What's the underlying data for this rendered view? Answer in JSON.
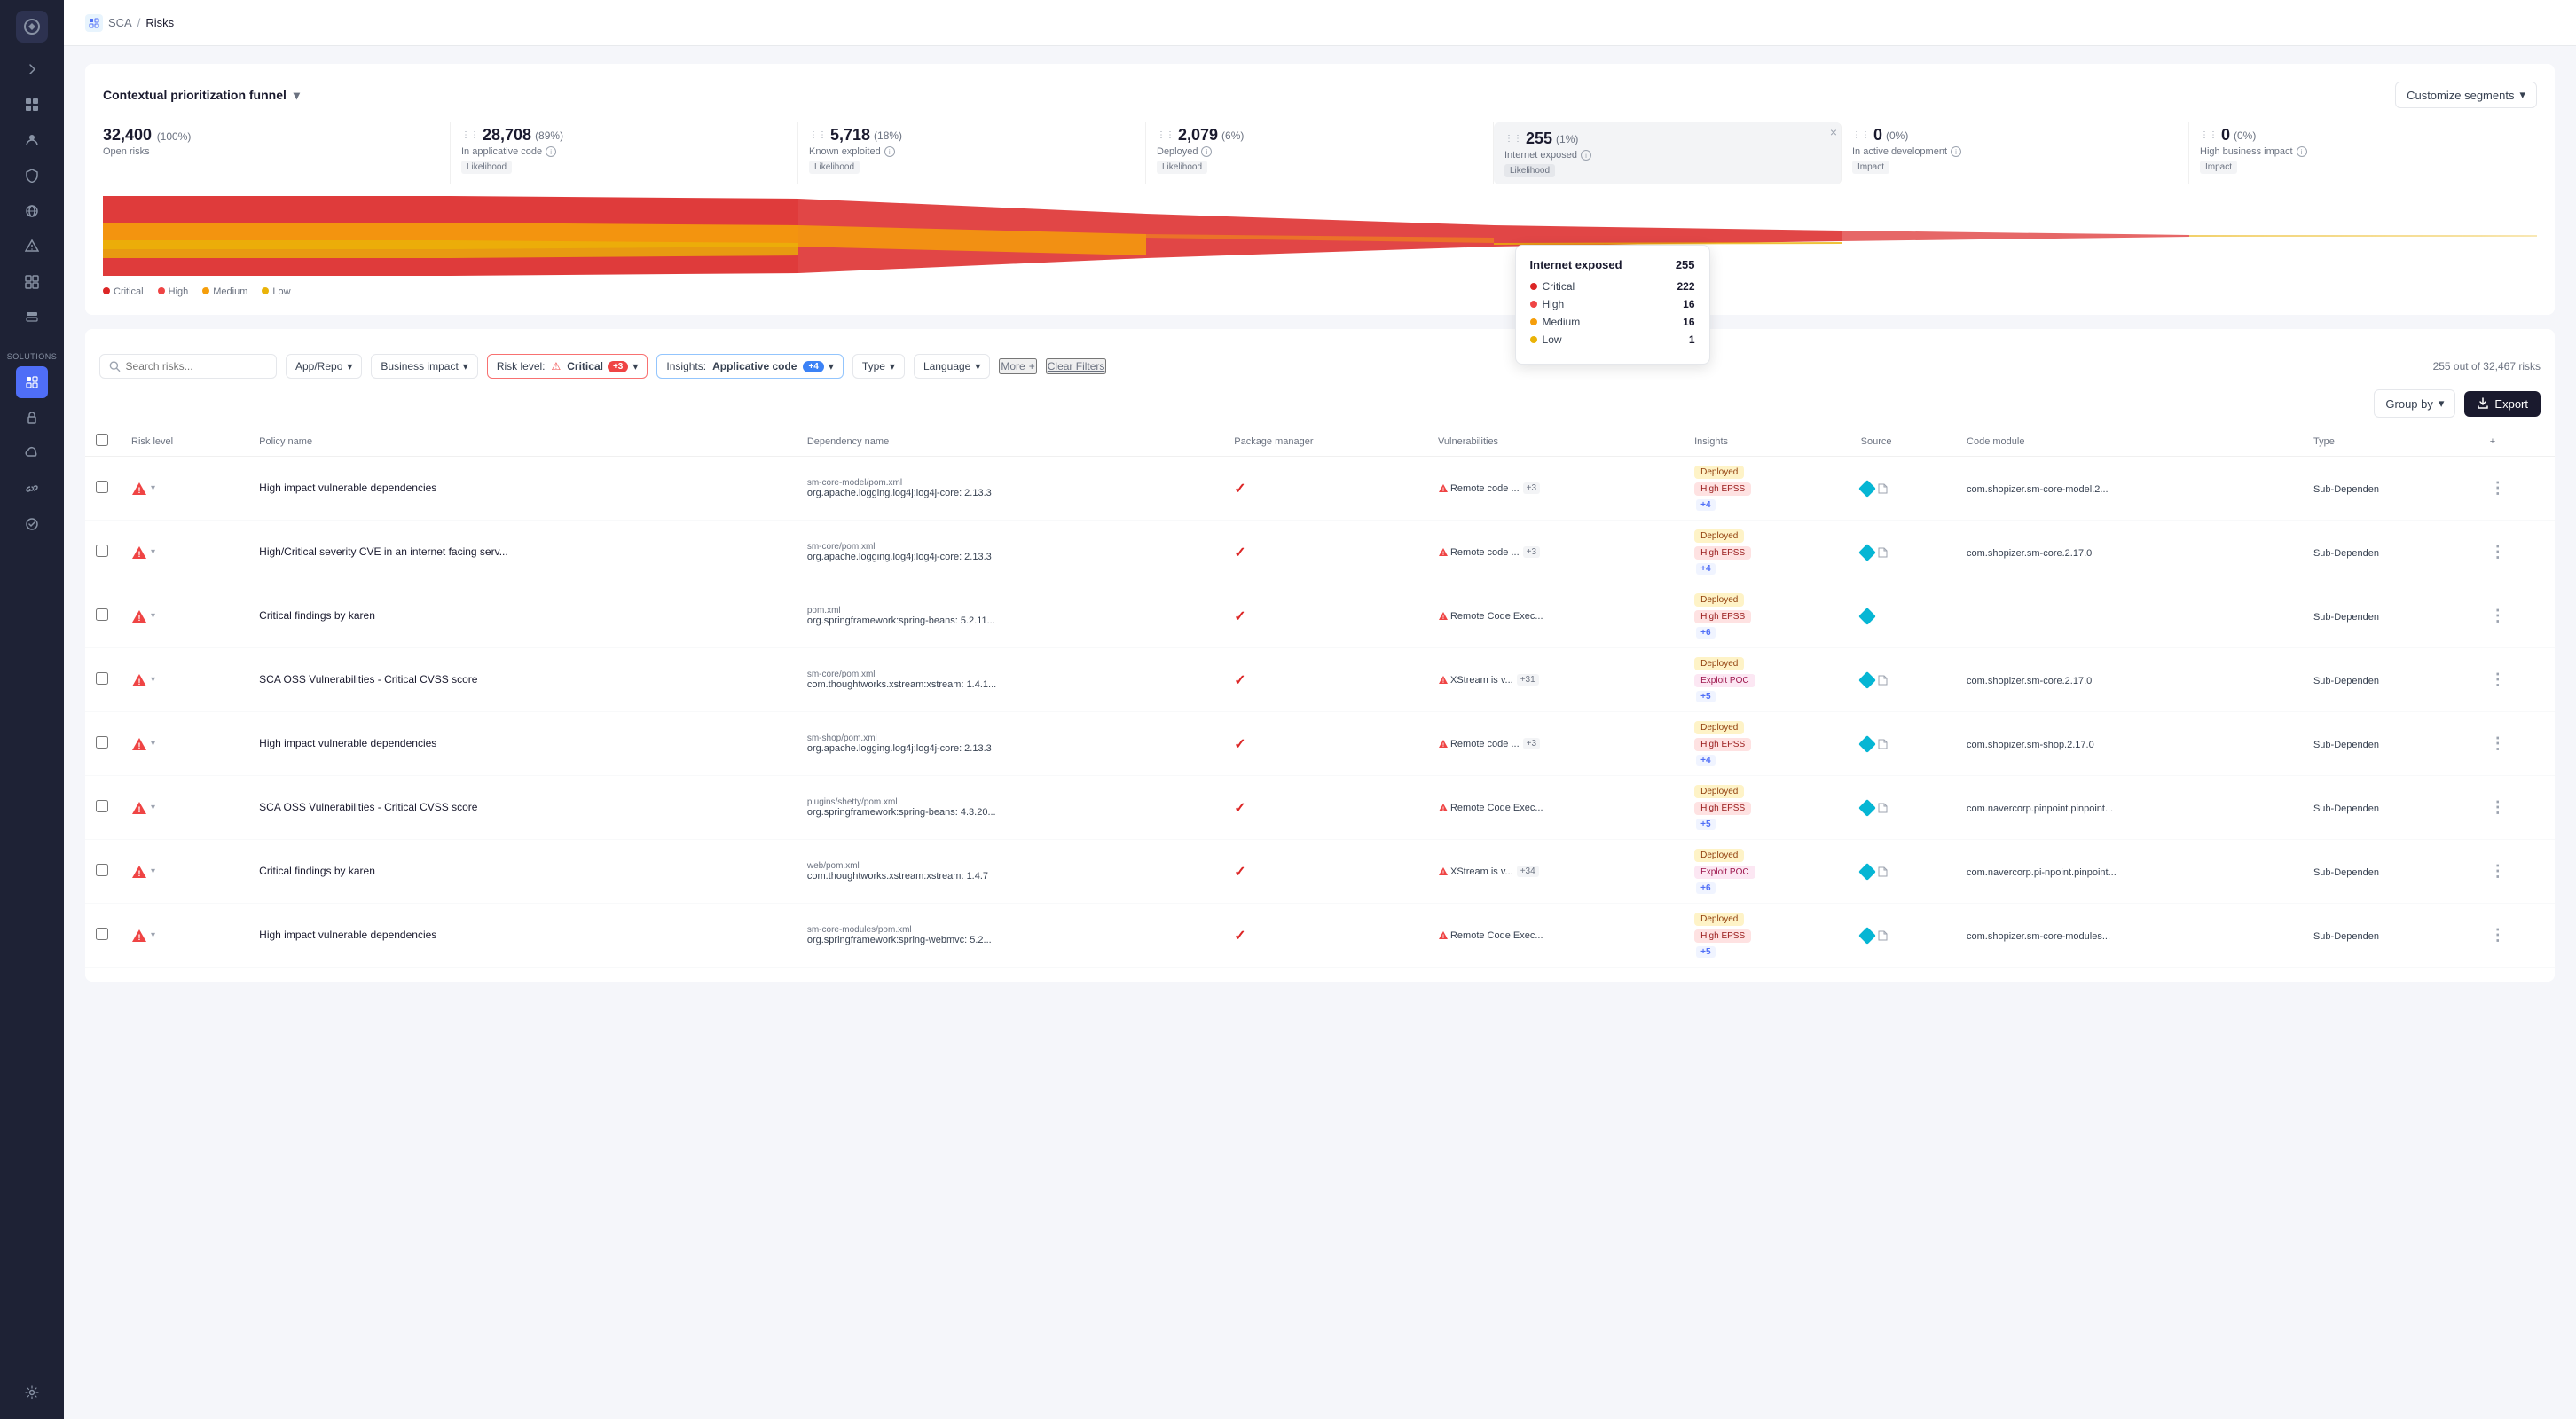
{
  "app": {
    "title": "SCA",
    "breadcrumb_sep": "/",
    "breadcrumb_current": "Risks"
  },
  "sidebar": {
    "solutions_label": "SOLUTIONS",
    "icons": [
      {
        "name": "expand-icon",
        "glyph": "⟩",
        "active": false
      },
      {
        "name": "dashboard-icon",
        "glyph": "○",
        "active": false
      },
      {
        "name": "team-icon",
        "glyph": "⊙",
        "active": false
      },
      {
        "name": "shield-icon",
        "glyph": "◻",
        "active": false
      },
      {
        "name": "globe-icon",
        "glyph": "◎",
        "active": false
      },
      {
        "name": "alert-icon",
        "glyph": "◈",
        "active": false
      },
      {
        "name": "widget-icon",
        "glyph": "⊞",
        "active": false
      },
      {
        "name": "box-icon",
        "glyph": "◧",
        "active": false
      },
      {
        "name": "sca-icon",
        "glyph": "◈",
        "active": true
      },
      {
        "name": "lock-icon",
        "glyph": "◻",
        "active": false
      },
      {
        "name": "cloud-icon",
        "glyph": "⊡",
        "active": false
      },
      {
        "name": "infinity-icon",
        "glyph": "∞",
        "active": false
      },
      {
        "name": "guard-icon",
        "glyph": "◎",
        "active": false
      },
      {
        "name": "settings-icon",
        "glyph": "⚙",
        "active": false
      }
    ]
  },
  "funnel": {
    "title": "Contextual prioritization funnel",
    "customize_label": "Customize segments",
    "segments": [
      {
        "number": "32,400",
        "pct": "(100%)",
        "label": "Open risks",
        "badge": "",
        "info": true,
        "likelihood": false,
        "impact": false,
        "close": false,
        "highlighted": false,
        "drag": false
      },
      {
        "number": "28,708",
        "pct": "(89%)",
        "label": "In applicative code",
        "badge": "Likelihood",
        "info": true,
        "close": false,
        "highlighted": false,
        "drag": true
      },
      {
        "number": "5,718",
        "pct": "(18%)",
        "label": "Known exploited",
        "badge": "Likelihood",
        "info": true,
        "close": false,
        "highlighted": false,
        "drag": true
      },
      {
        "number": "2,079",
        "pct": "(6%)",
        "label": "Deployed",
        "badge": "Likelihood",
        "info": true,
        "close": false,
        "highlighted": false,
        "drag": true
      },
      {
        "number": "255",
        "pct": "(1%)",
        "label": "Internet exposed",
        "badge": "Likelihood",
        "info": true,
        "close": true,
        "highlighted": true,
        "drag": true
      },
      {
        "number": "0",
        "pct": "(0%)",
        "label": "In active development",
        "badge": "Impact",
        "info": true,
        "close": false,
        "highlighted": false,
        "drag": true
      },
      {
        "number": "0",
        "pct": "(0%)",
        "label": "High business impact",
        "badge": "Impact",
        "info": true,
        "close": false,
        "highlighted": false,
        "drag": true
      }
    ],
    "legend": [
      {
        "color": "#dc2626",
        "label": "Critical"
      },
      {
        "color": "#ef4444",
        "label": "High"
      },
      {
        "color": "#f59e0b",
        "label": "Medium"
      },
      {
        "color": "#eab308",
        "label": "Low"
      }
    ],
    "tooltip": {
      "title": "Internet exposed",
      "count": "255",
      "rows": [
        {
          "color": "#dc2626",
          "label": "Critical",
          "value": "222"
        },
        {
          "color": "#ef4444",
          "label": "High",
          "value": "16"
        },
        {
          "color": "#f59e0b",
          "label": "Medium",
          "value": "16"
        },
        {
          "color": "#eab308",
          "label": "Low",
          "value": "1"
        }
      ]
    }
  },
  "filters": {
    "search_placeholder": "Search risks...",
    "app_repo_label": "App/Repo",
    "business_impact_label": "Business impact",
    "risk_level_label": "Risk level:",
    "risk_level_value": "🚨 Critical",
    "risk_level_count": "+3",
    "insights_label": "Insights:",
    "insights_value": "Applicative code",
    "insights_count": "+4",
    "type_label": "Type",
    "language_label": "Language",
    "more_label": "More",
    "clear_label": "Clear Filters",
    "results_count": "255 out of 32,467 risks"
  },
  "table": {
    "group_by_label": "Group by",
    "export_label": "Export",
    "headers": [
      {
        "key": "checkbox",
        "label": ""
      },
      {
        "key": "risk_level",
        "label": "Risk level"
      },
      {
        "key": "policy_name",
        "label": "Policy name"
      },
      {
        "key": "dependency_name",
        "label": "Dependency name"
      },
      {
        "key": "package_manager",
        "label": "Package manager"
      },
      {
        "key": "vulnerabilities",
        "label": "Vulnerabilities"
      },
      {
        "key": "insights",
        "label": "Insights"
      },
      {
        "key": "source",
        "label": "Source"
      },
      {
        "key": "code_module",
        "label": "Code module"
      },
      {
        "key": "type",
        "label": "Type"
      },
      {
        "key": "actions",
        "label": "+"
      }
    ],
    "rows": [
      {
        "risk_level": "high",
        "policy_name": "High impact vulnerable dependencies",
        "dep_file": "sm-core-model/pom.xml",
        "dep_name": "org.apache.logging.log4j:log4j-core: 2.13.3",
        "pkg_manager": "✓",
        "vuln": "Remote code ...",
        "vuln_plus": "+3",
        "insight1": "Deployed",
        "insight2": "High EPSS",
        "insight3": "",
        "insights_plus": "+4",
        "source": "diamond",
        "source_file": true,
        "code_module": "com.shopizer.sm-core-model.2...",
        "type": "Sub-Dependen"
      },
      {
        "risk_level": "high",
        "policy_name": "High/Critical severity CVE in an internet facing serv...",
        "dep_file": "sm-core/pom.xml",
        "dep_name": "org.apache.logging.log4j:log4j-core: 2.13.3",
        "pkg_manager": "✓",
        "vuln": "Remote code ...",
        "vuln_plus": "+3",
        "insight1": "Deployed",
        "insight2": "High EPSS",
        "insight3": "",
        "insights_plus": "+4",
        "source": "diamond",
        "source_file": true,
        "code_module": "com.shopizer.sm-core.2.17.0",
        "type": "Sub-Dependen"
      },
      {
        "risk_level": "high",
        "policy_name": "Critical findings by karen",
        "dep_file": "pom.xml",
        "dep_name": "org.springframework:spring-beans: 5.2.11...",
        "pkg_manager": "✓",
        "vuln": "Remote Code Exec...",
        "vuln_plus": "",
        "insight1": "Deployed",
        "insight2": "High EPSS",
        "insight3": "",
        "insights_plus": "+6",
        "source": "diamond",
        "source_file": false,
        "code_module": "",
        "type": "Sub-Dependen"
      },
      {
        "risk_level": "high",
        "policy_name": "SCA OSS Vulnerabilities - Critical CVSS score",
        "dep_file": "sm-core/pom.xml",
        "dep_name": "com.thoughtworks.xstream:xstream: 1.4.1...",
        "pkg_manager": "✓",
        "vuln": "XStream is v...",
        "vuln_plus": "+31",
        "insight1": "Deployed",
        "insight2": "Exploit POC",
        "insight3": "",
        "insights_plus": "+5",
        "source": "diamond",
        "source_file": true,
        "code_module": "com.shopizer.sm-core.2.17.0",
        "type": "Sub-Dependen"
      },
      {
        "risk_level": "high",
        "policy_name": "High impact vulnerable dependencies",
        "dep_file": "sm-shop/pom.xml",
        "dep_name": "org.apache.logging.log4j:log4j-core: 2.13.3",
        "pkg_manager": "✓",
        "vuln": "Remote code ...",
        "vuln_plus": "+3",
        "insight1": "Deployed",
        "insight2": "High EPSS",
        "insight3": "",
        "insights_plus": "+4",
        "source": "diamond",
        "source_file": true,
        "code_module": "com.shopizer.sm-shop.2.17.0",
        "type": "Sub-Dependen"
      },
      {
        "risk_level": "high",
        "policy_name": "SCA OSS Vulnerabilities - Critical CVSS score",
        "dep_file": "plugins/shetty/pom.xml",
        "dep_name": "org.springframework:spring-beans: 4.3.20...",
        "pkg_manager": "✓",
        "vuln": "Remote Code Exec...",
        "vuln_plus": "",
        "insight1": "Deployed",
        "insight2": "High EPSS",
        "insight3": "",
        "insights_plus": "+5",
        "source": "diamond",
        "source_file": true,
        "code_module": "com.navercorp.pinpoint.pinpoint...",
        "type": "Sub-Dependen"
      },
      {
        "risk_level": "high",
        "policy_name": "Critical findings by karen",
        "dep_file": "web/pom.xml",
        "dep_name": "com.thoughtworks.xstream:xstream: 1.4.7",
        "pkg_manager": "✓",
        "vuln": "XStream is v...",
        "vuln_plus": "+34",
        "insight1": "Deployed",
        "insight2": "Exploit POC",
        "insight3": "",
        "insights_plus": "+6",
        "source": "diamond",
        "source_file": true,
        "code_module": "com.navercorp.pi-npoint.pinpoint...",
        "type": "Sub-Dependen"
      },
      {
        "risk_level": "high",
        "policy_name": "High impact vulnerable dependencies",
        "dep_file": "sm-core-modules/pom.xml",
        "dep_name": "org.springframework:spring-webmvc: 5.2...",
        "pkg_manager": "✓",
        "vuln": "Remote Code Exec...",
        "vuln_plus": "",
        "insight1": "Deployed",
        "insight2": "High EPSS",
        "insight3": "",
        "insights_plus": "+5",
        "source": "diamond",
        "source_file": true,
        "code_module": "com.shopizer.sm-core-modules...",
        "type": "Sub-Dependen"
      }
    ]
  },
  "colors": {
    "critical": "#dc2626",
    "high": "#ef4444",
    "medium": "#f59e0b",
    "low": "#eab308",
    "accent": "#4f6ef7",
    "sidebar_bg": "#1e2235",
    "highlight_bg": "#f9fafb"
  }
}
